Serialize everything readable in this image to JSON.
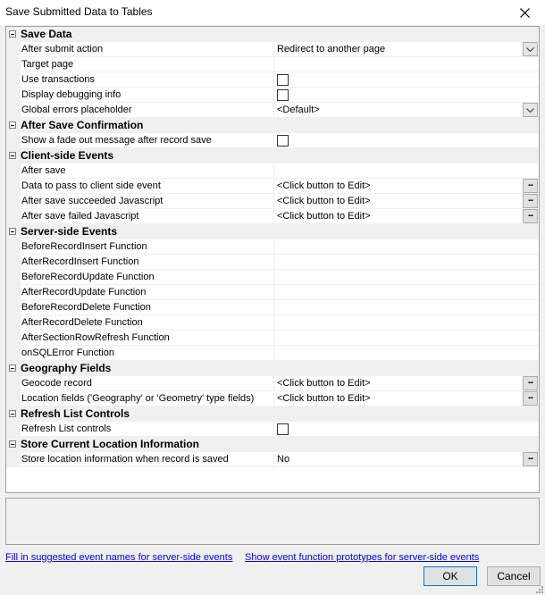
{
  "window": {
    "title": "Save Submitted Data to Tables"
  },
  "categories": [
    {
      "label": "Save Data",
      "props": [
        {
          "name": "After submit action",
          "value": "Redirect to another page",
          "control": "dropdown"
        },
        {
          "name": "Target page",
          "value": "",
          "control": "text"
        },
        {
          "name": "Use transactions",
          "value": "",
          "control": "checkbox"
        },
        {
          "name": "Display debugging info",
          "value": "",
          "control": "checkbox"
        },
        {
          "name": "Global errors placeholder",
          "value": "<Default>",
          "control": "dropdown"
        }
      ]
    },
    {
      "label": "After Save Confirmation",
      "props": [
        {
          "name": "Show a fade out message after record save",
          "value": "",
          "control": "checkbox"
        }
      ]
    },
    {
      "label": "Client-side Events",
      "props": [
        {
          "name": "After save",
          "value": "",
          "control": "text"
        },
        {
          "name": "Data to pass to client side event",
          "value": "<Click button to Edit>",
          "control": "button"
        },
        {
          "name": "After save succeeded Javascript",
          "value": "<Click button to Edit>",
          "control": "button"
        },
        {
          "name": "After save failed Javascript",
          "value": "<Click button to Edit>",
          "control": "button"
        }
      ]
    },
    {
      "label": "Server-side Events",
      "props": [
        {
          "name": "BeforeRecordInsert Function",
          "value": "",
          "control": "text"
        },
        {
          "name": "AfterRecordInsert Function",
          "value": "",
          "control": "text"
        },
        {
          "name": "BeforeRecordUpdate Function",
          "value": "",
          "control": "text"
        },
        {
          "name": "AfterRecordUpdate Function",
          "value": "",
          "control": "text"
        },
        {
          "name": "BeforeRecordDelete Function",
          "value": "",
          "control": "text"
        },
        {
          "name": "AfterRecordDelete Function",
          "value": "",
          "control": "text"
        },
        {
          "name": "AfterSectionRowRefresh Function",
          "value": "",
          "control": "text"
        },
        {
          "name": "onSQLError Function",
          "value": "",
          "control": "text"
        }
      ]
    },
    {
      "label": "Geography Fields",
      "props": [
        {
          "name": "Geocode record",
          "value": "<Click button to Edit>",
          "control": "button"
        },
        {
          "name": "Location fields ('Geography' or 'Geometry' type fields)",
          "value": "<Click button to Edit>",
          "control": "button"
        }
      ]
    },
    {
      "label": "Refresh List Controls",
      "props": [
        {
          "name": "Refresh List controls",
          "value": "",
          "control": "checkbox"
        }
      ]
    },
    {
      "label": "Store Current Location Information",
      "props": [
        {
          "name": "Store location information when record is saved",
          "value": "No",
          "control": "button"
        }
      ]
    }
  ],
  "footer": {
    "link_fill": "Fill in suggested event names for server-side events",
    "link_show": "Show event function prototypes for server-side events",
    "ok_label": "OK",
    "cancel_label": "Cancel",
    "dots_label": "..."
  },
  "colors": {
    "link": "#0000ee",
    "ok_border": "#0078d7",
    "category_bg": "#f0f0f0"
  }
}
